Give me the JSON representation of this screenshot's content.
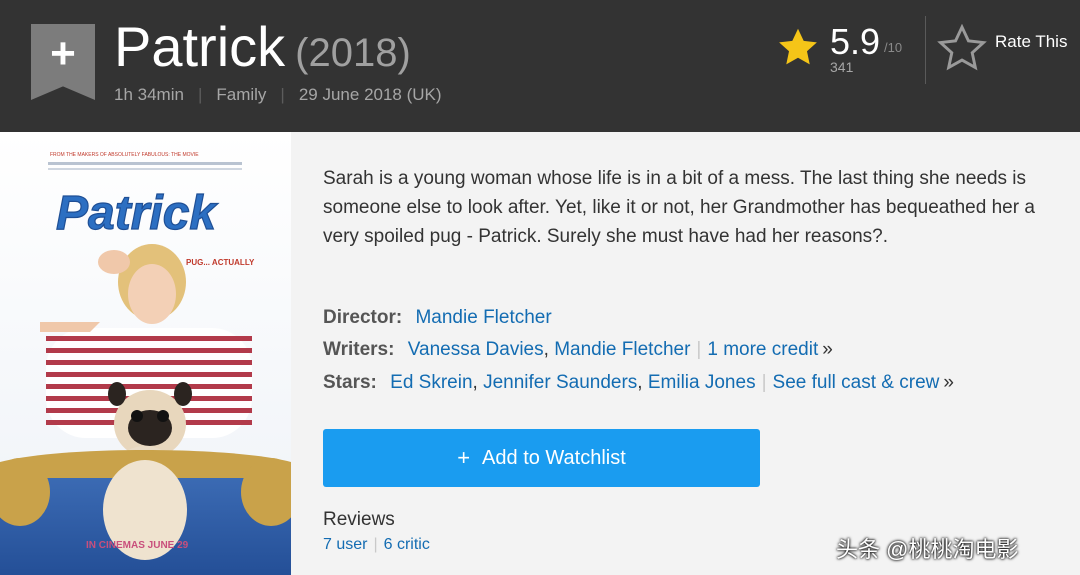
{
  "header": {
    "add_icon": "plus-icon",
    "title": "Patrick",
    "year": "(2018)",
    "runtime": "1h 34min",
    "genre": "Family",
    "release_date": "29 June 2018 (UK)",
    "rating": {
      "value": "5.9",
      "scale": "/10",
      "count": "341",
      "star_color": "#f5c518"
    },
    "rate_this": "Rate This"
  },
  "poster": {
    "title": "Patrick",
    "tagline": "PUG... ACTUALLY",
    "top_line": "FROM THE MAKERS OF ABSOLUTELY FABULOUS: THE MOVIE",
    "bottom_line": "IN CINEMAS JUNE 29"
  },
  "summary": "Sarah is a young woman whose life is in a bit of a mess. The last thing she needs is someone else to look after. Yet, like it or not, her Grandmother has bequeathed her a very spoiled pug - Patrick. Surely she must have had her reasons?.",
  "credits": {
    "director_label": "Director:",
    "director": "Mandie Fletcher",
    "writers_label": "Writers:",
    "writers": [
      "Vanessa Davies",
      "Mandie Fletcher"
    ],
    "writers_more": "1 more credit",
    "stars_label": "Stars:",
    "stars": [
      "Ed Skrein",
      "Jennifer Saunders",
      "Emilia Jones"
    ],
    "stars_more": "See full cast & crew",
    "more_glyph": "»"
  },
  "watchlist": {
    "label": "Add to Watchlist",
    "icon": "+",
    "color": "#1a9cf0"
  },
  "reviews": {
    "title": "Reviews",
    "user": "7 user",
    "critic": "6 critic"
  },
  "watermark": "头条 @桃桃淘电影",
  "colors": {
    "header_bg": "#333333",
    "link": "#136cb2",
    "page_bg": "#f3f3f3"
  }
}
